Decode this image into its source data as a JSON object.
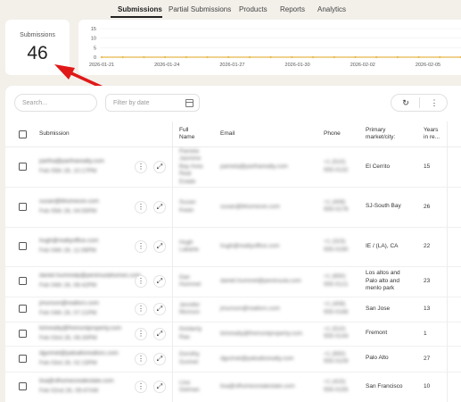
{
  "nav": {
    "tabs": [
      "Submissions",
      "Partial Submissions",
      "Products",
      "Reports",
      "Analytics"
    ],
    "active": 0
  },
  "stat": {
    "label": "Submissions",
    "value": "46"
  },
  "chart_data": {
    "type": "line",
    "y_ticks": [
      0,
      5,
      10,
      15
    ],
    "x_ticks": [
      "2026-01-21",
      "2026-01-24",
      "2026-01-27",
      "2026-01-30",
      "2026-02-02",
      "2026-02-05"
    ],
    "series": [
      {
        "values": [
          0,
          0,
          0,
          0,
          0,
          0,
          0,
          0,
          0,
          0,
          0,
          0,
          0,
          0,
          0,
          0,
          0,
          0
        ]
      }
    ],
    "ylim": [
      0,
      15
    ],
    "color": "#e8b84a"
  },
  "toolbar": {
    "search_placeholder": "Search...",
    "filter_placeholder": "Filter by date",
    "refresh_icon": "↻",
    "more_icon": "⋮"
  },
  "table": {
    "headers": {
      "submission": "Submission",
      "full_name": [
        "Full",
        "Name"
      ],
      "email": "Email",
      "phone": "Phone",
      "market": [
        "Primary",
        "market/city:"
      ],
      "years": [
        "Years",
        "in re..."
      ]
    },
    "rows": [
      {
        "sub1": "partha@partharealty.com",
        "sub2": "Feb 05th 26, 10:17PM",
        "name": [
          "Pamela",
          "Jasmine",
          "Bay Area",
          "Real",
          "Estate"
        ],
        "email": "pamela@partharealty.com",
        "phone": [
          "+1 (510)",
          "555-0132"
        ],
        "market": [
          "El Cerrito"
        ],
        "years": "15"
      },
      {
        "sub1": "susan@bhomesre.com",
        "sub2": "Feb 05th 26, 04:55PM",
        "name": [
          "Susan",
          "Kwan"
        ],
        "email": "susan@bhomesre.com",
        "phone": [
          "+1 (408)",
          "555-0178"
        ],
        "market": [
          "SJ-South Bay"
        ],
        "years": "26"
      },
      {
        "sub1": "hugh@realtyoffice.com",
        "sub2": "Feb 04th 26, 11:08PM",
        "name": [
          "Hugh",
          "Labarte"
        ],
        "email": "hugh@realtyoffice.com",
        "phone": [
          "+1 (323)",
          "555-0190"
        ],
        "market": [
          "IE / (LA), CA"
        ],
        "years": "22"
      },
      {
        "sub1": "daniel.hummelp@peninsulahomes.com",
        "sub2": "Feb 04th 26, 08:42PM",
        "name": [
          "Dan",
          "Hummel"
        ],
        "email": "daniel.hummel@peninsula.com",
        "phone": [
          "+1 (650)",
          "555-0121"
        ],
        "market": [
          "Los altos and",
          "Palo alto and",
          "menlo park"
        ],
        "years": "23"
      },
      {
        "sub1": "jmunson@realtors.com",
        "sub2": "Feb 04th 26, 07:21PM",
        "name": [
          "Jennifer",
          "Munson"
        ],
        "email": "jmunson@realtors.com",
        "phone": [
          "+1 (408)",
          "555-0166"
        ],
        "market": [
          "San Jose"
        ],
        "years": "13"
      },
      {
        "sub1": "kimrealty@fremontproperty.com",
        "sub2": "Feb 03rd 26, 06:30PM",
        "name": [
          "Kimberly",
          "Rao"
        ],
        "email": "kimrealty@fremontproperty.com",
        "phone": [
          "+1 (510)",
          "555-0144"
        ],
        "market": [
          "Fremont"
        ],
        "years": "1"
      },
      {
        "sub1": "dgurinet@paloaltorealtors.com",
        "sub2": "Feb 03rd 26, 02:15PM",
        "name": [
          "Dorothy",
          "Gurinet"
        ],
        "email": "dgurinet@paloaltorealty.com",
        "phone": [
          "+1 (650)",
          "555-0109"
        ],
        "market": [
          "Palo Alto"
        ],
        "years": "27"
      },
      {
        "sub1": "lisa@sfhomesrealestate.com",
        "sub2": "Feb 02nd 26, 09:47AM",
        "name": [
          "Lisa",
          "Gelman"
        ],
        "email": "lisa@sfhomesrealestate.com",
        "phone": [
          "+1 (415)",
          "555-0155"
        ],
        "market": [
          "San Francisco"
        ],
        "years": "10"
      }
    ]
  },
  "icons": {
    "more_vertical": "⋮",
    "expand": "⤢"
  },
  "colors": {
    "background": "#f3f0ea",
    "arrow": "#e01818",
    "line": "#e8b84a"
  }
}
